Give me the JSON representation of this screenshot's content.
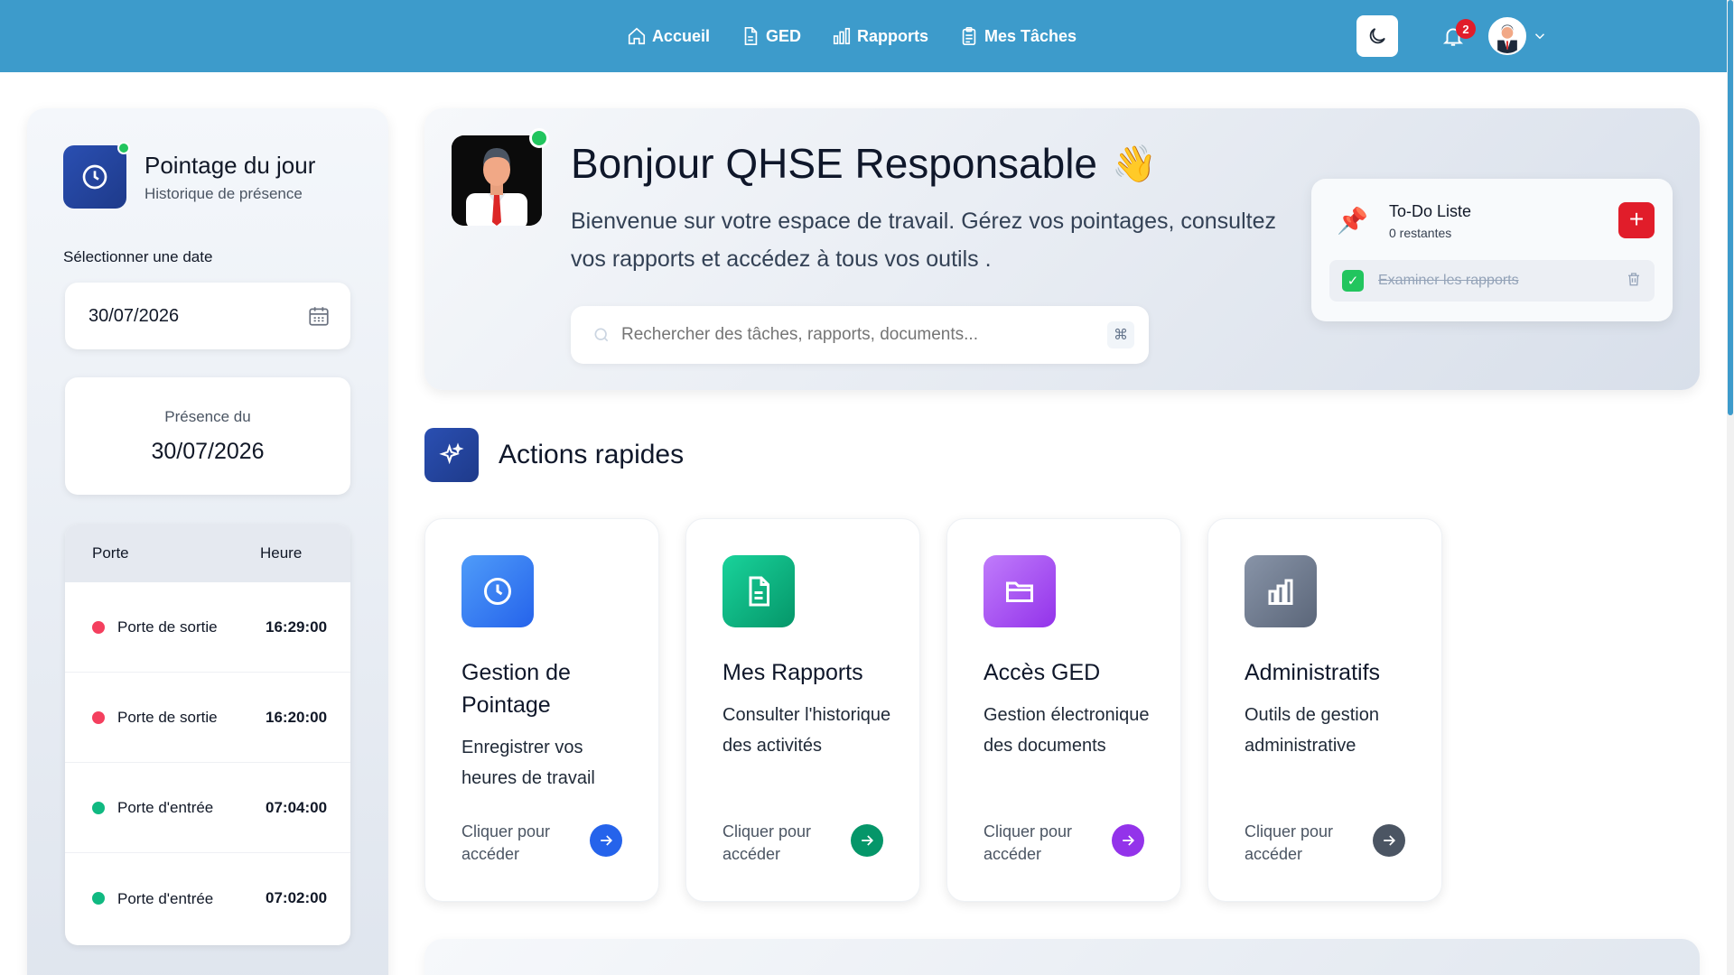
{
  "nav": {
    "items": [
      {
        "label": "Accueil",
        "icon": "home-icon"
      },
      {
        "label": "GED",
        "icon": "document-icon"
      },
      {
        "label": "Rapports",
        "icon": "bar-chart-icon"
      },
      {
        "label": "Mes Tâches",
        "icon": "clipboard-icon"
      }
    ],
    "notification_count": "2"
  },
  "sidebar": {
    "title": "Pointage du jour",
    "subtitle": "Historique de présence",
    "select_label": "Sélectionner une date",
    "date_value": "30/07/2026",
    "presence_label": "Présence du",
    "presence_date": "30/07/2026",
    "table": {
      "headers": [
        "Porte",
        "Heure"
      ],
      "rows": [
        {
          "porte": "Porte de sortie",
          "heure": "16:29:00",
          "status": "exit"
        },
        {
          "porte": "Porte de sortie",
          "heure": "16:20:00",
          "status": "exit"
        },
        {
          "porte": "Porte d'entrée",
          "heure": "07:04:00",
          "status": "entry"
        },
        {
          "porte": "Porte d'entrée",
          "heure": "07:02:00",
          "status": "entry"
        }
      ]
    }
  },
  "hero": {
    "greeting": "Bonjour QHSE Responsable",
    "wave": "👋",
    "description": "Bienvenue sur votre espace de travail. Gérez vos pointages, consultez vos rapports et accédez à tous vos outils .",
    "search_placeholder": "Rechercher des tâches, rapports, documents...",
    "search_shortcut": "⌘"
  },
  "todo": {
    "title": "To-Do Liste",
    "remaining": "0 restantes",
    "add_label": "+",
    "items": [
      {
        "text": "Examiner les rapports",
        "done": true
      }
    ]
  },
  "actions": {
    "title": "Actions rapides",
    "cards": [
      {
        "title": "Gestion de Pointage",
        "description": "Enregistrer vos heures de travail",
        "cta": "Cliquer pour accéder",
        "icon": "clock-icon",
        "color": "#3b82f6"
      },
      {
        "title": "Mes Rapports",
        "description": "Consulter l'historique des activités",
        "cta": "Cliquer pour accéder",
        "icon": "file-text-icon",
        "color": "#10b981"
      },
      {
        "title": "Accès GED",
        "description": "Gestion électronique des documents",
        "cta": "Cliquer pour accéder",
        "icon": "folder-icon",
        "color": "#a855f7"
      },
      {
        "title": "Administratifs",
        "description": "Outils de gestion administrative",
        "cta": "Cliquer pour accéder",
        "icon": "bar-chart-icon",
        "color": "#64748b"
      }
    ]
  },
  "colors": {
    "topbar": "#3d9bcb",
    "exit_dot": "#f43f5e",
    "entry_dot": "#10b981",
    "accent_red": "#e11d2a"
  }
}
